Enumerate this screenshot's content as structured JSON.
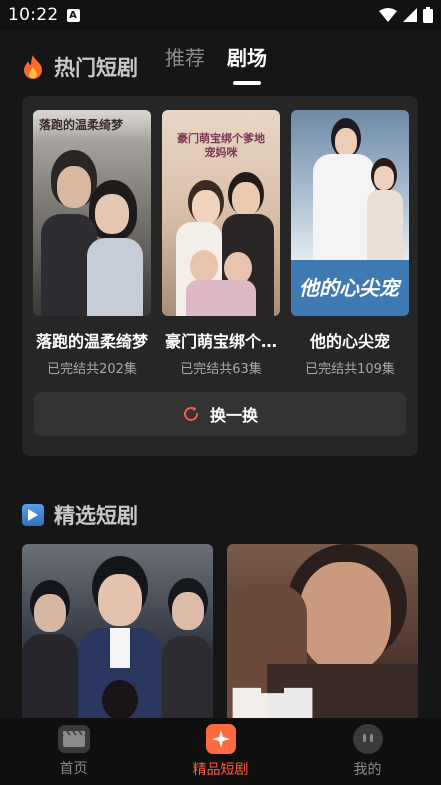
{
  "status_bar": {
    "time": "10:22",
    "notif_icon": "A"
  },
  "header": {
    "hot_title": "热门短剧",
    "hot_icon": "fire-icon",
    "tabs": [
      {
        "label": "推荐",
        "active": false
      },
      {
        "label": "剧场",
        "active": true
      }
    ]
  },
  "hot_dramas": [
    {
      "title": "落跑的温柔绮梦",
      "sub": "已完结共202集",
      "poster_text": "落跑的温柔绮梦"
    },
    {
      "title": "豪门萌宝绑个…",
      "sub": "已完结共63集",
      "poster_text": "豪门萌宝绑个爹地宠妈咪"
    },
    {
      "title": "他的心尖宠",
      "sub": "已完结共109集",
      "poster_text": "他的心尖宠"
    }
  ],
  "refresh_label": "换一换",
  "selected": {
    "title": "精选短剧",
    "icon": "play-icon"
  },
  "bottom_nav": [
    {
      "label": "首页",
      "icon": "clapperboard-icon",
      "active": false
    },
    {
      "label": "精品短剧",
      "icon": "sparkle-icon",
      "active": true
    },
    {
      "label": "我的",
      "icon": "profile-icon",
      "active": false
    }
  ],
  "colors": {
    "accent": "#ff5a3c",
    "background": "#161616",
    "card": "#262626"
  }
}
